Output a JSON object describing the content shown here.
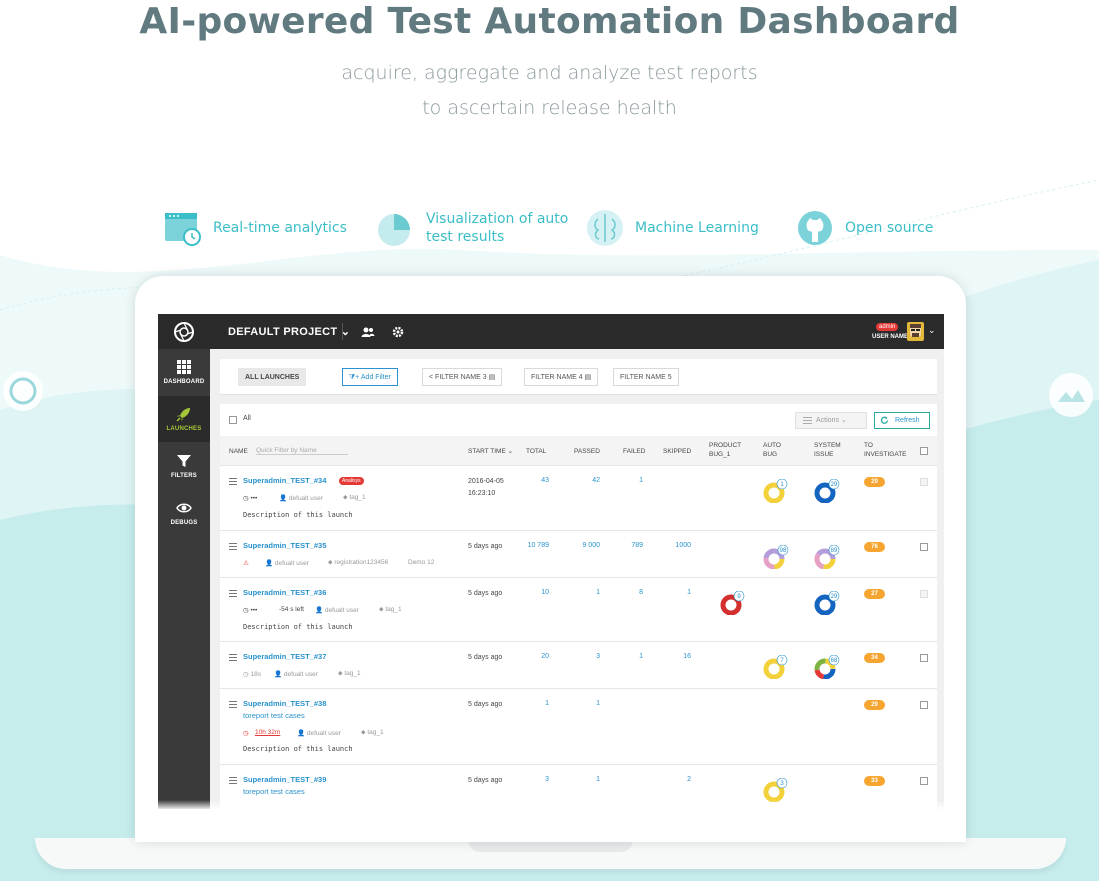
{
  "hero": {
    "title": "AI-powered Test Automation Dashboard",
    "subtitle_line1": "acquire, aggregate and analyze test reports",
    "subtitle_line2": "to ascertain release health"
  },
  "features": [
    {
      "label": "Real-time analytics",
      "icon": "calendar-clock-icon"
    },
    {
      "label_line1": "Visualization of auto",
      "label_line2": "test results",
      "icon": "pie-chart-icon"
    },
    {
      "label": "Machine Learning",
      "icon": "brain-icon"
    },
    {
      "label": "Open source",
      "icon": "github-icon"
    }
  ],
  "colors": {
    "accent": "#3bbec7",
    "link": "#2a92cc",
    "header_bg": "#2b2b2b",
    "sidebar_bg": "#3a3a3a",
    "active_green": "#a4c639",
    "to_investigate": "#f7a531",
    "wave": "#c6ecec"
  },
  "app": {
    "project": "DEFAULT PROJECT",
    "admin_badge": "admin",
    "user_name": "USER NAME",
    "sidebar": [
      {
        "label": "DASHBOARD",
        "icon": "grid-icon"
      },
      {
        "label": "LAUNCHES",
        "icon": "rocket-icon",
        "active": true
      },
      {
        "label": "FILTERS",
        "icon": "funnel-icon"
      },
      {
        "label": "DEBUGS",
        "icon": "eye-icon"
      }
    ],
    "filters": {
      "all_launches": "ALL LAUNCHES",
      "add_filter": "Add Filter",
      "filter3": "FILTER NAME 3",
      "filter4": "FILTER NAME 4",
      "filter5": "FILTER NAME 5"
    },
    "list": {
      "all_label": "All",
      "actions": "Actions",
      "refresh": "Refresh",
      "quick_filter_placeholder": "Quick Filter by Name",
      "headers": {
        "name": "NAME",
        "start_time": "START TIME",
        "total": "TOTAL",
        "passed": "PASSED",
        "failed": "FAILED",
        "skipped": "SKIPPED",
        "product_bug_1": "PRODUCT",
        "product_bug_2": "BUG_1",
        "auto_bug_1": "AUTO",
        "auto_bug_2": "BUG",
        "system_issue_1": "SYSTEM",
        "system_issue_2": "ISSUE",
        "to_investigate_1": "TO",
        "to_investigate_2": "INVESTIGATE"
      },
      "rows": [
        {
          "name": "Superadmin_TEST_#34",
          "badge": "Analisys",
          "progress": "•••",
          "owner": "defualt user",
          "tag": "tag_1",
          "description": "Description of this launch",
          "start_line1": "2016-04-05",
          "start_line2": "16:23:10",
          "total": "43",
          "passed": "42",
          "failed": "1",
          "skipped": "",
          "auto_bug": "1",
          "system_issue": "29",
          "to_investigate": "29"
        },
        {
          "name": "Superadmin_TEST_#35",
          "owner": "defualt user",
          "tag": "registration123456",
          "tag2": "Demo 12",
          "start_line1": "5 days ago",
          "total": "10 789",
          "passed": "9 000",
          "failed": "789",
          "skipped": "1000",
          "auto_bug": "98",
          "system_issue": "89",
          "to_investigate": "76"
        },
        {
          "name": "Superadmin_TEST_#36",
          "progress": "•••",
          "time_left": "-54 s left",
          "owner": "defualt user",
          "tag": "tag_1",
          "description": "Description of this launch",
          "start_line1": "5 days ago",
          "total": "10",
          "passed": "1",
          "failed": "8",
          "skipped": "1",
          "product_bug": "9",
          "system_issue": "29",
          "to_investigate": "27"
        },
        {
          "name": "Superadmin_TEST_#37",
          "duration": "18s",
          "owner": "defualt user",
          "tag": "tag_1",
          "start_line1": "5 days ago",
          "total": "20",
          "passed": "3",
          "failed": "1",
          "skipped": "16",
          "auto_bug": "7",
          "system_issue": "68",
          "to_investigate": "34"
        },
        {
          "name": "Superadmin_TEST_#38",
          "subtitle": "toreport test cases",
          "duration": "10h 32m",
          "owner": "defualt user",
          "tag": "tag_1",
          "description": "Description of this launch",
          "start_line1": "5 days ago",
          "total": "1",
          "passed": "1",
          "failed": "",
          "skipped": "",
          "to_investigate": "29"
        },
        {
          "name": "Superadmin_TEST_#39",
          "subtitle": "toreport test cases",
          "start_line1": "5 days ago",
          "total": "3",
          "passed": "1",
          "failed": "",
          "skipped": "2",
          "auto_bug": "3",
          "to_investigate": "33"
        }
      ]
    }
  }
}
